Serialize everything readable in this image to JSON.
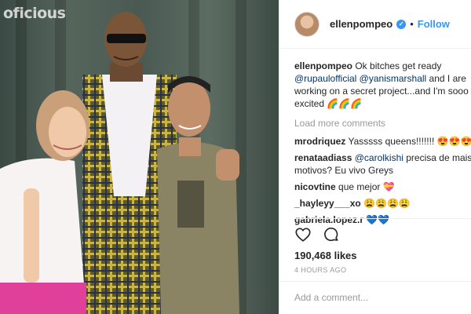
{
  "photo": {
    "watermark": "oficious"
  },
  "post": {
    "username": "ellenpompeo",
    "verified_mark": "✓",
    "separator": "•",
    "follow_label": "Follow",
    "caption": {
      "username": "ellenpompeo",
      "line1_text": " Ok bitches get ready",
      "mention1": "@rupaulofficial",
      "mention2": " @yanismarshall",
      "line2_text": " and I are",
      "line3_text": "working on a secret project...and I'm sooo",
      "line4_text": "excited 🌈🌈🌈"
    },
    "load_more_label": "Load more comments",
    "comments": [
      {
        "user": "mrodriquez",
        "text": " Yasssss queens!!!!!!! 😍😍😍😍"
      },
      {
        "user": "renataadiass",
        "mention": " @carolkishi",
        "text": " precisa de mais",
        "line2": "motivos? Eu vivo Greys"
      },
      {
        "user": "nicovtine",
        "text": " que mejor 💝"
      },
      {
        "user": "_hayleyy___xo",
        "text": " 😩😩😩😩"
      },
      {
        "user": "gabriela.lopez.r",
        "text": " 💙💙"
      }
    ],
    "likes": "190,468 likes",
    "time": "4 HOURS AGO",
    "add_comment_placeholder": "Add a comment..."
  },
  "icons": {
    "like": "heart-icon",
    "comment": "speech-bubble-icon",
    "verified": "verified-badge-icon"
  },
  "colors": {
    "accent": "#3897f0",
    "mention": "#003569",
    "muted": "#999999",
    "text": "#262626",
    "border": "#efefef"
  }
}
